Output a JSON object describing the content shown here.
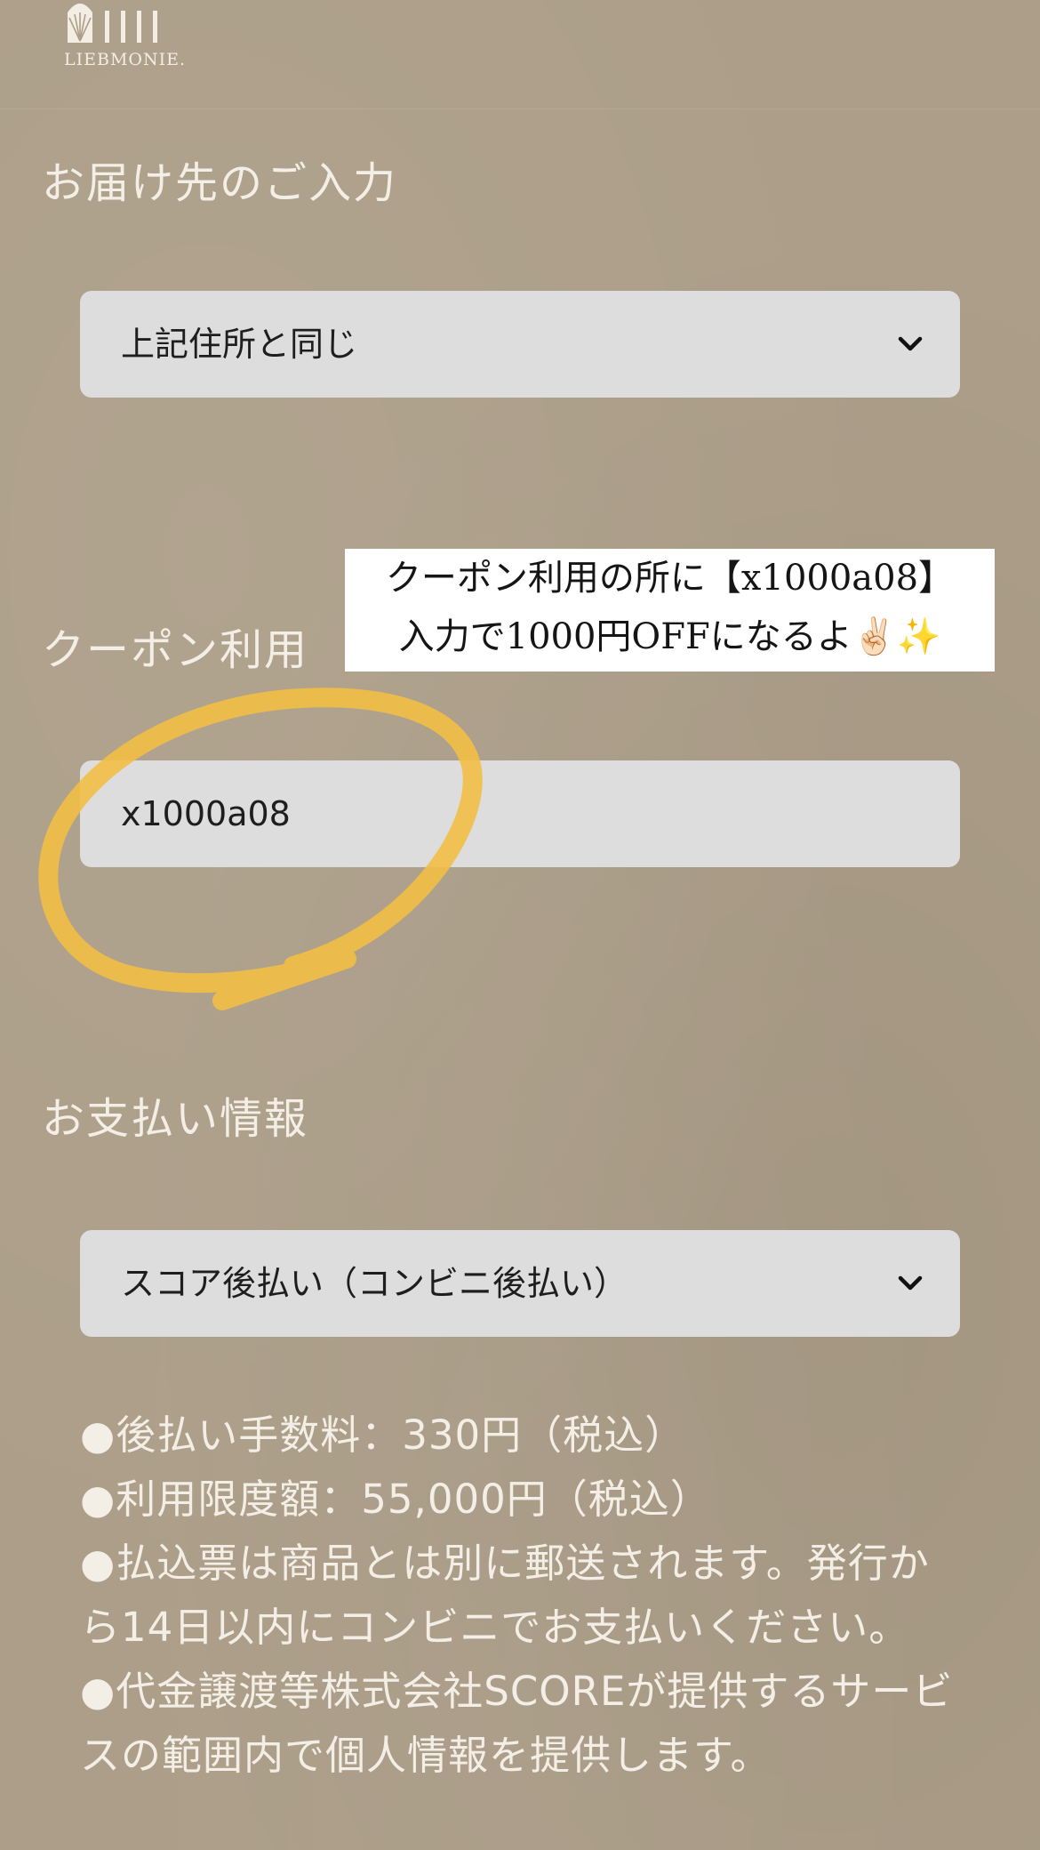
{
  "brand": {
    "logo_text": "LIEBMONIE."
  },
  "delivery": {
    "title": "お届け先のご入力",
    "selected": "上記住所と同じ"
  },
  "coupon": {
    "title": "クーポン利用",
    "value": "x1000a08",
    "annotation_line1": "クーポン利用の所に【x1000a08】",
    "annotation_line2": "入力で1000円OFFになるよ✌🏻✨"
  },
  "payment": {
    "title": "お支払い情報",
    "selected": "スコア後払い（コンビニ後払い）",
    "notes": [
      "●後払い手数料：330円（税込）",
      "●利用限度額：55,000円（税込）",
      "●払込票は商品とは別に郵送されます。発行から14日以内にコンビニでお支払いください。",
      "●代金譲渡等株式会社SCOREが提供するサービスの範囲内で個人情報を提供します。"
    ]
  },
  "colors": {
    "background": "#ac9e88",
    "field": "#dddddd",
    "highlight_circle": "#f2be45",
    "text_light": "#f4efe6"
  },
  "icons": {
    "dropdown": "chevron-down-icon",
    "logo": "sunburst-logo-icon"
  }
}
